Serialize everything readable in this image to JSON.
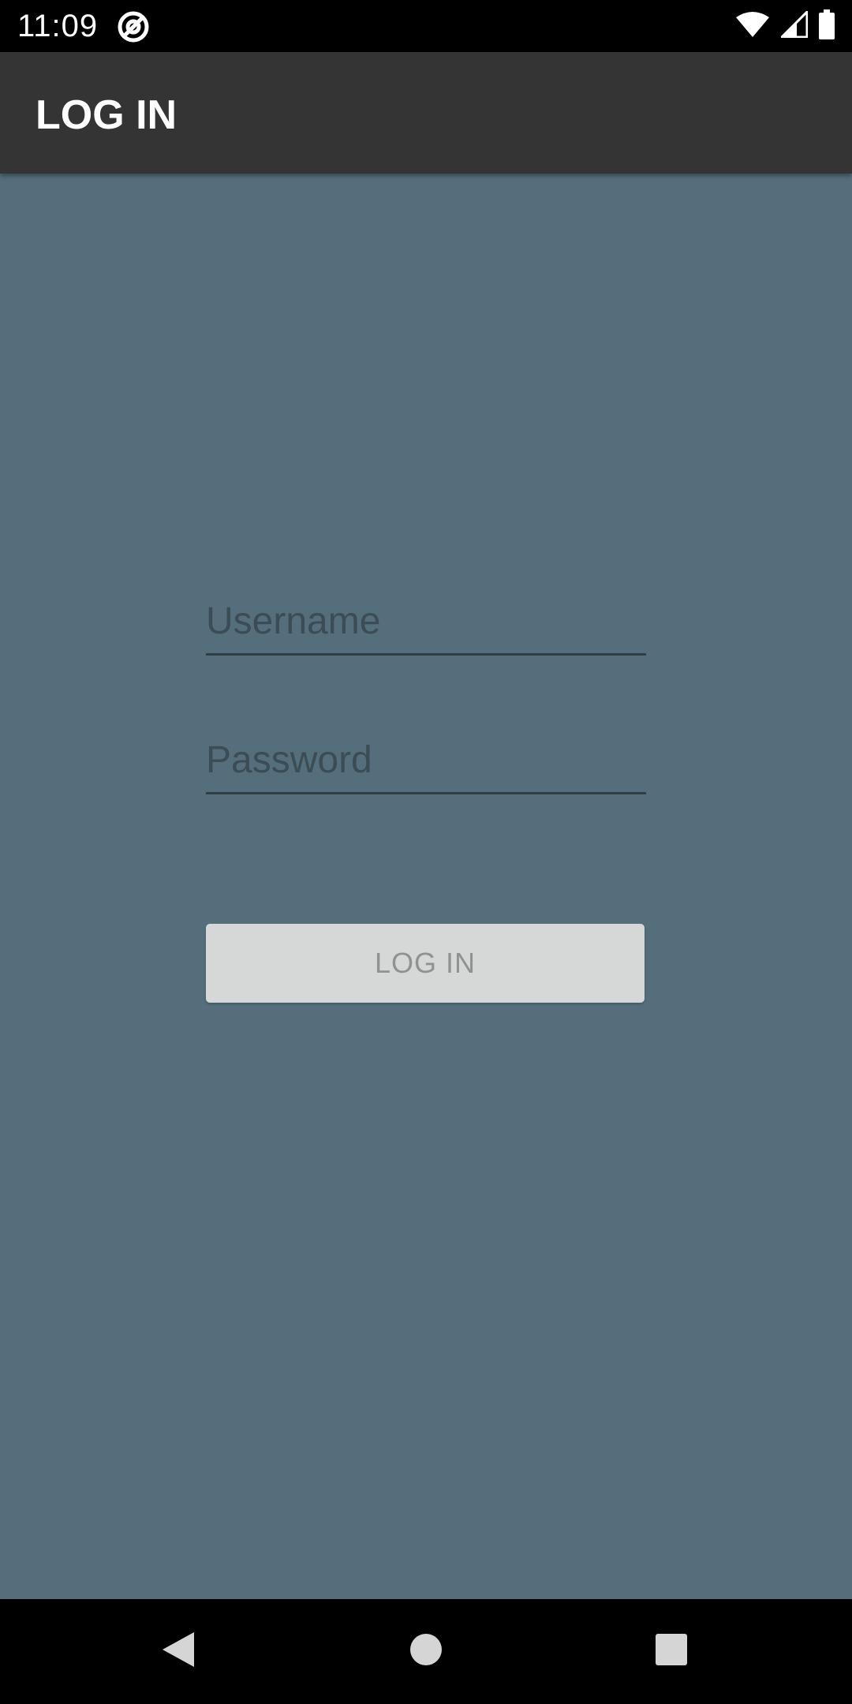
{
  "status_bar": {
    "time": "11:09",
    "icons": [
      "at-sign-icon",
      "wifi-icon",
      "cell-signal-icon",
      "battery-icon"
    ]
  },
  "app_bar": {
    "title": "LOG IN"
  },
  "form": {
    "username_placeholder": "Username",
    "username_value": "",
    "password_placeholder": "Password",
    "password_value": "",
    "submit_label": "LOG IN"
  },
  "nav_bar": {
    "buttons": [
      "back-icon",
      "home-icon",
      "recents-icon"
    ]
  },
  "colors": {
    "background": "#546f7b",
    "app_bar": "#343434",
    "button_disabled": "#d6d7d7",
    "button_text_disabled": "#909292"
  }
}
